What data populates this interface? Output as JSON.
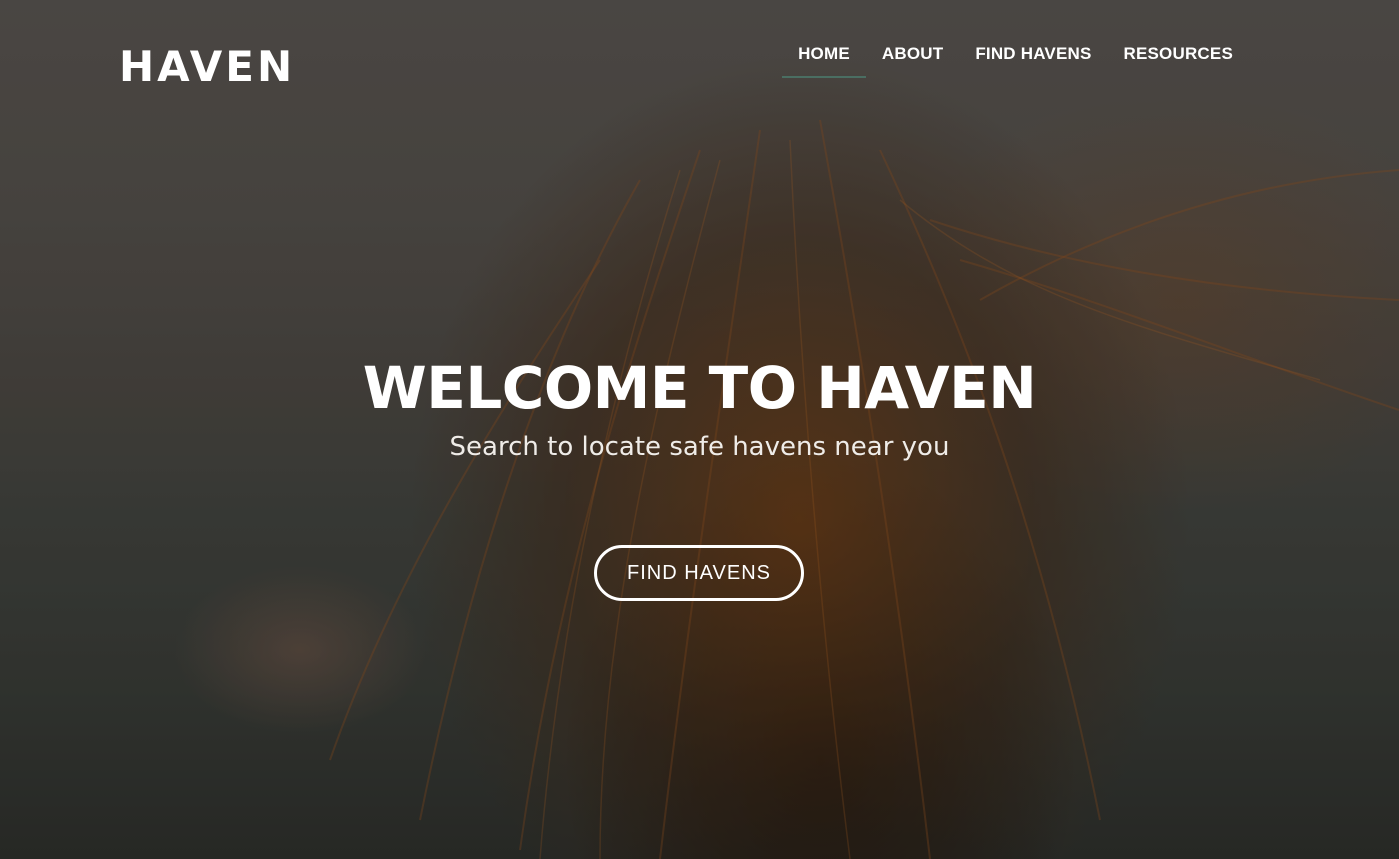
{
  "brand": {
    "logo_text": "HAVEN"
  },
  "nav": {
    "items": [
      {
        "label": "HOME",
        "active": true
      },
      {
        "label": "ABOUT",
        "active": false
      },
      {
        "label": "FIND HAVENS",
        "active": false
      },
      {
        "label": "RESOURCES",
        "active": false
      }
    ]
  },
  "hero": {
    "title": "WELCOME TO HAVEN",
    "subtitle": "Search to locate safe havens near you",
    "cta_label": "FIND HAVENS"
  },
  "colors": {
    "text": "#ffffff",
    "nav_active_underline": "#4a6e62",
    "background_dark": "#3b3a36",
    "hair_accent": "#8a4a1c"
  }
}
